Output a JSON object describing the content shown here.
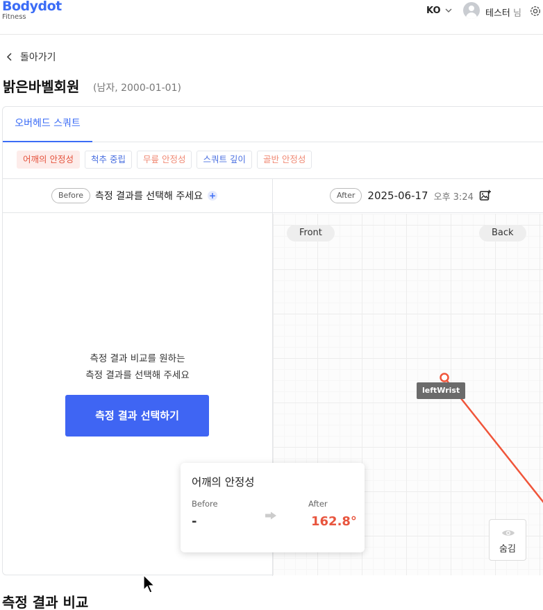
{
  "header": {
    "logo_main": "Bodydot",
    "logo_sub": "Fitness",
    "language": "KO",
    "user_name": "테스터",
    "user_suffix": "님",
    "icons": [
      "chevron-down-icon",
      "avatar-icon",
      "gear-icon"
    ]
  },
  "nav": {
    "back_label": "돌아가기"
  },
  "member": {
    "name": "밝은바벨회원",
    "info": "(남자, 2000-01-01)"
  },
  "tabs": [
    {
      "label": "오버헤드 스쿼트",
      "active": true
    }
  ],
  "metric_chips": [
    {
      "label": "어깨의 안정성",
      "active": true
    },
    {
      "label": "척추 중립",
      "active": false
    },
    {
      "label": "무릎 안정성",
      "active": false
    },
    {
      "label": "스쿼트 깊이",
      "active": false
    },
    {
      "label": "골반 안정성",
      "active": false
    }
  ],
  "before": {
    "pill": "Before",
    "heading": "측정 결과를 선택해 주세요",
    "plus_icon": "+",
    "empty_line1": "측정 결과 비교를 원하는",
    "empty_line2": "측정 결과를 선택해 주세요",
    "select_button": "측정 결과 선택하기"
  },
  "after": {
    "pill": "After",
    "date": "2025-06-17",
    "time": "오후 3:24",
    "front_label": "Front",
    "back_label": "Back",
    "joint_label": "leftWrist",
    "pose_color": "#f0553a",
    "hide_label": "숨김"
  },
  "metric_popup": {
    "title": "어깨의 안정성",
    "before_label": "Before",
    "before_value": "-",
    "after_label": "After",
    "after_value": "162.8°",
    "after_color": "#e8553e"
  },
  "section_title": "측정 결과 비교",
  "colors": {
    "accent": "#3b6cf6",
    "button": "#3f65f3",
    "highlight": "#e5533d"
  }
}
